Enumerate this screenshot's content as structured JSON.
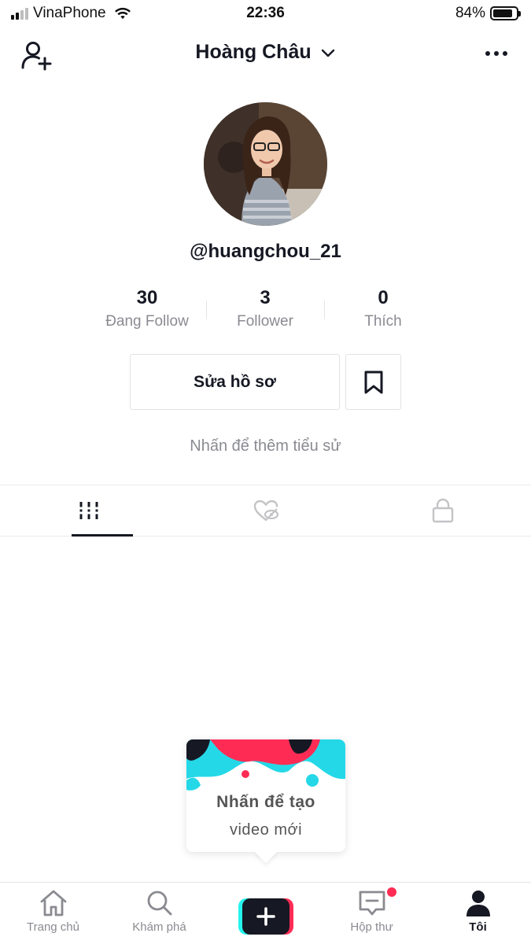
{
  "status_bar": {
    "carrier": "VinaPhone",
    "time": "22:36",
    "battery_percent_text": "84%",
    "battery_level": 0.84,
    "signal_bars": 2,
    "signal_total": 4
  },
  "header": {
    "title": "Hoàng Châu"
  },
  "profile": {
    "username": "@huangchou_21",
    "stats": [
      {
        "value": "30",
        "label": "Đang Follow"
      },
      {
        "value": "3",
        "label": "Follower"
      },
      {
        "value": "0",
        "label": "Thích"
      }
    ],
    "edit_profile_label": "Sửa hồ sơ",
    "bio_hint": "Nhấn để thêm tiểu sử"
  },
  "tabs": {
    "items": [
      "videos-grid-icon",
      "liked-hidden-icon",
      "private-lock-icon"
    ],
    "active_index": 0
  },
  "create_popover": {
    "line1": "Nhấn để tạo",
    "line2": "video mới"
  },
  "bottom_nav": {
    "items": [
      {
        "label": "Trang chủ",
        "icon": "home-icon"
      },
      {
        "label": "Khám phá",
        "icon": "search-icon"
      },
      {
        "label": "",
        "icon": "create-plus-icon"
      },
      {
        "label": "Hộp thư",
        "icon": "inbox-icon",
        "has_notification": true
      },
      {
        "label": "Tôi",
        "icon": "profile-icon",
        "active": true
      }
    ]
  },
  "colors": {
    "accent_red": "#fe2c55",
    "accent_cyan": "#25f4ee",
    "text_primary": "#161823",
    "text_secondary": "#8a8b91"
  }
}
